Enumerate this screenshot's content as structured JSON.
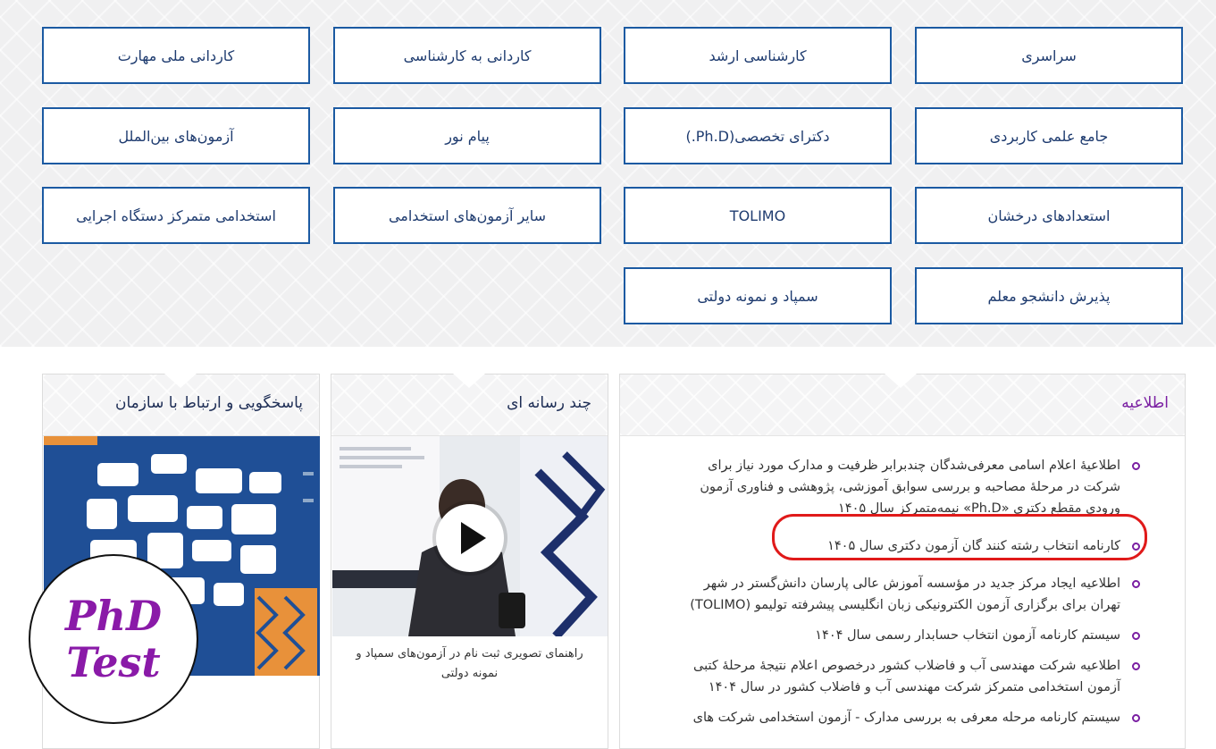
{
  "grid": [
    {
      "label": "سراسری"
    },
    {
      "label": "کارشناسی ارشد"
    },
    {
      "label": "کاردانی به کارشناسی"
    },
    {
      "label": "کاردانی ملی مهارت"
    },
    {
      "label": "جامع علمی کاربردی"
    },
    {
      "label": "دکترای تخصصی(Ph.D.)"
    },
    {
      "label": "پیام نور"
    },
    {
      "label": "آزمون‌های بین‌الملل"
    },
    {
      "label": "استعدادهای درخشان"
    },
    {
      "label": "TOLIMO"
    },
    {
      "label": "سایر آزمون‌های استخدامی"
    },
    {
      "label": "استخدامی متمرکز دستگاه اجرایی"
    },
    {
      "label": "پذیرش دانشجو معلم"
    },
    {
      "label": "سمپاد و نمونه دولتی"
    }
  ],
  "announcements": {
    "title": "اطلاعیه",
    "items": [
      {
        "text": "اطلاعیۀ اعلام اسامی معرفی‌شدگان چندبرابر ظرفیت و مدارک مورد نیاز برای شرکت در مرحلۀ مصاحبه و بررسی سوابق آموزشی، پژوهشی و فناوری آزمون ورودی مقطع دکتری «Ph.D» نیمه‌متمرکز سال ۱۴۰۵"
      },
      {
        "text": "کارنامه انتخاب رشته کنند گان آزمون دکتری سال ۱۴۰۵"
      },
      {
        "text": "اطلاعیه ایجاد مرکز جدید در مؤسسه آموزش عالی پارسان دانش‌گستر در شهر تهران برای برگزاری آزمون الکترونیکی زبان انگلیسی پیشرفته تولیمو (TOLIMO)"
      },
      {
        "text": "سیستم کارنامه آزمون انتخاب حسابدار رسمی سال ۱۴۰۴"
      },
      {
        "text": "اطلاعیه شرکت مهندسی آب و فاضلاب کشور درخصوص اعلام نتیجۀ مرحلۀ کتبی آزمون استخدامی متمرکز شرکت مهندسی آب و فاضلاب کشور در سال ۱۴۰۴"
      },
      {
        "text": "سیستم کارنامه مرحله معرفی به بررسی مدارک - آزمون استخدامی شرکت های"
      }
    ]
  },
  "media": {
    "title": "چند رسانه ای",
    "caption": "راهنمای تصویری ثبت نام در آزمون‌های سمپاد و نمونه دولتی"
  },
  "contact": {
    "title": "پاسخگویی و ارتباط با سازمان"
  },
  "badge": {
    "line1": "PhD",
    "line2": "Test"
  },
  "colors": {
    "accent": "#1b5aa2",
    "bullet": "#7a1fa2",
    "highlight": "#e01a1a"
  }
}
